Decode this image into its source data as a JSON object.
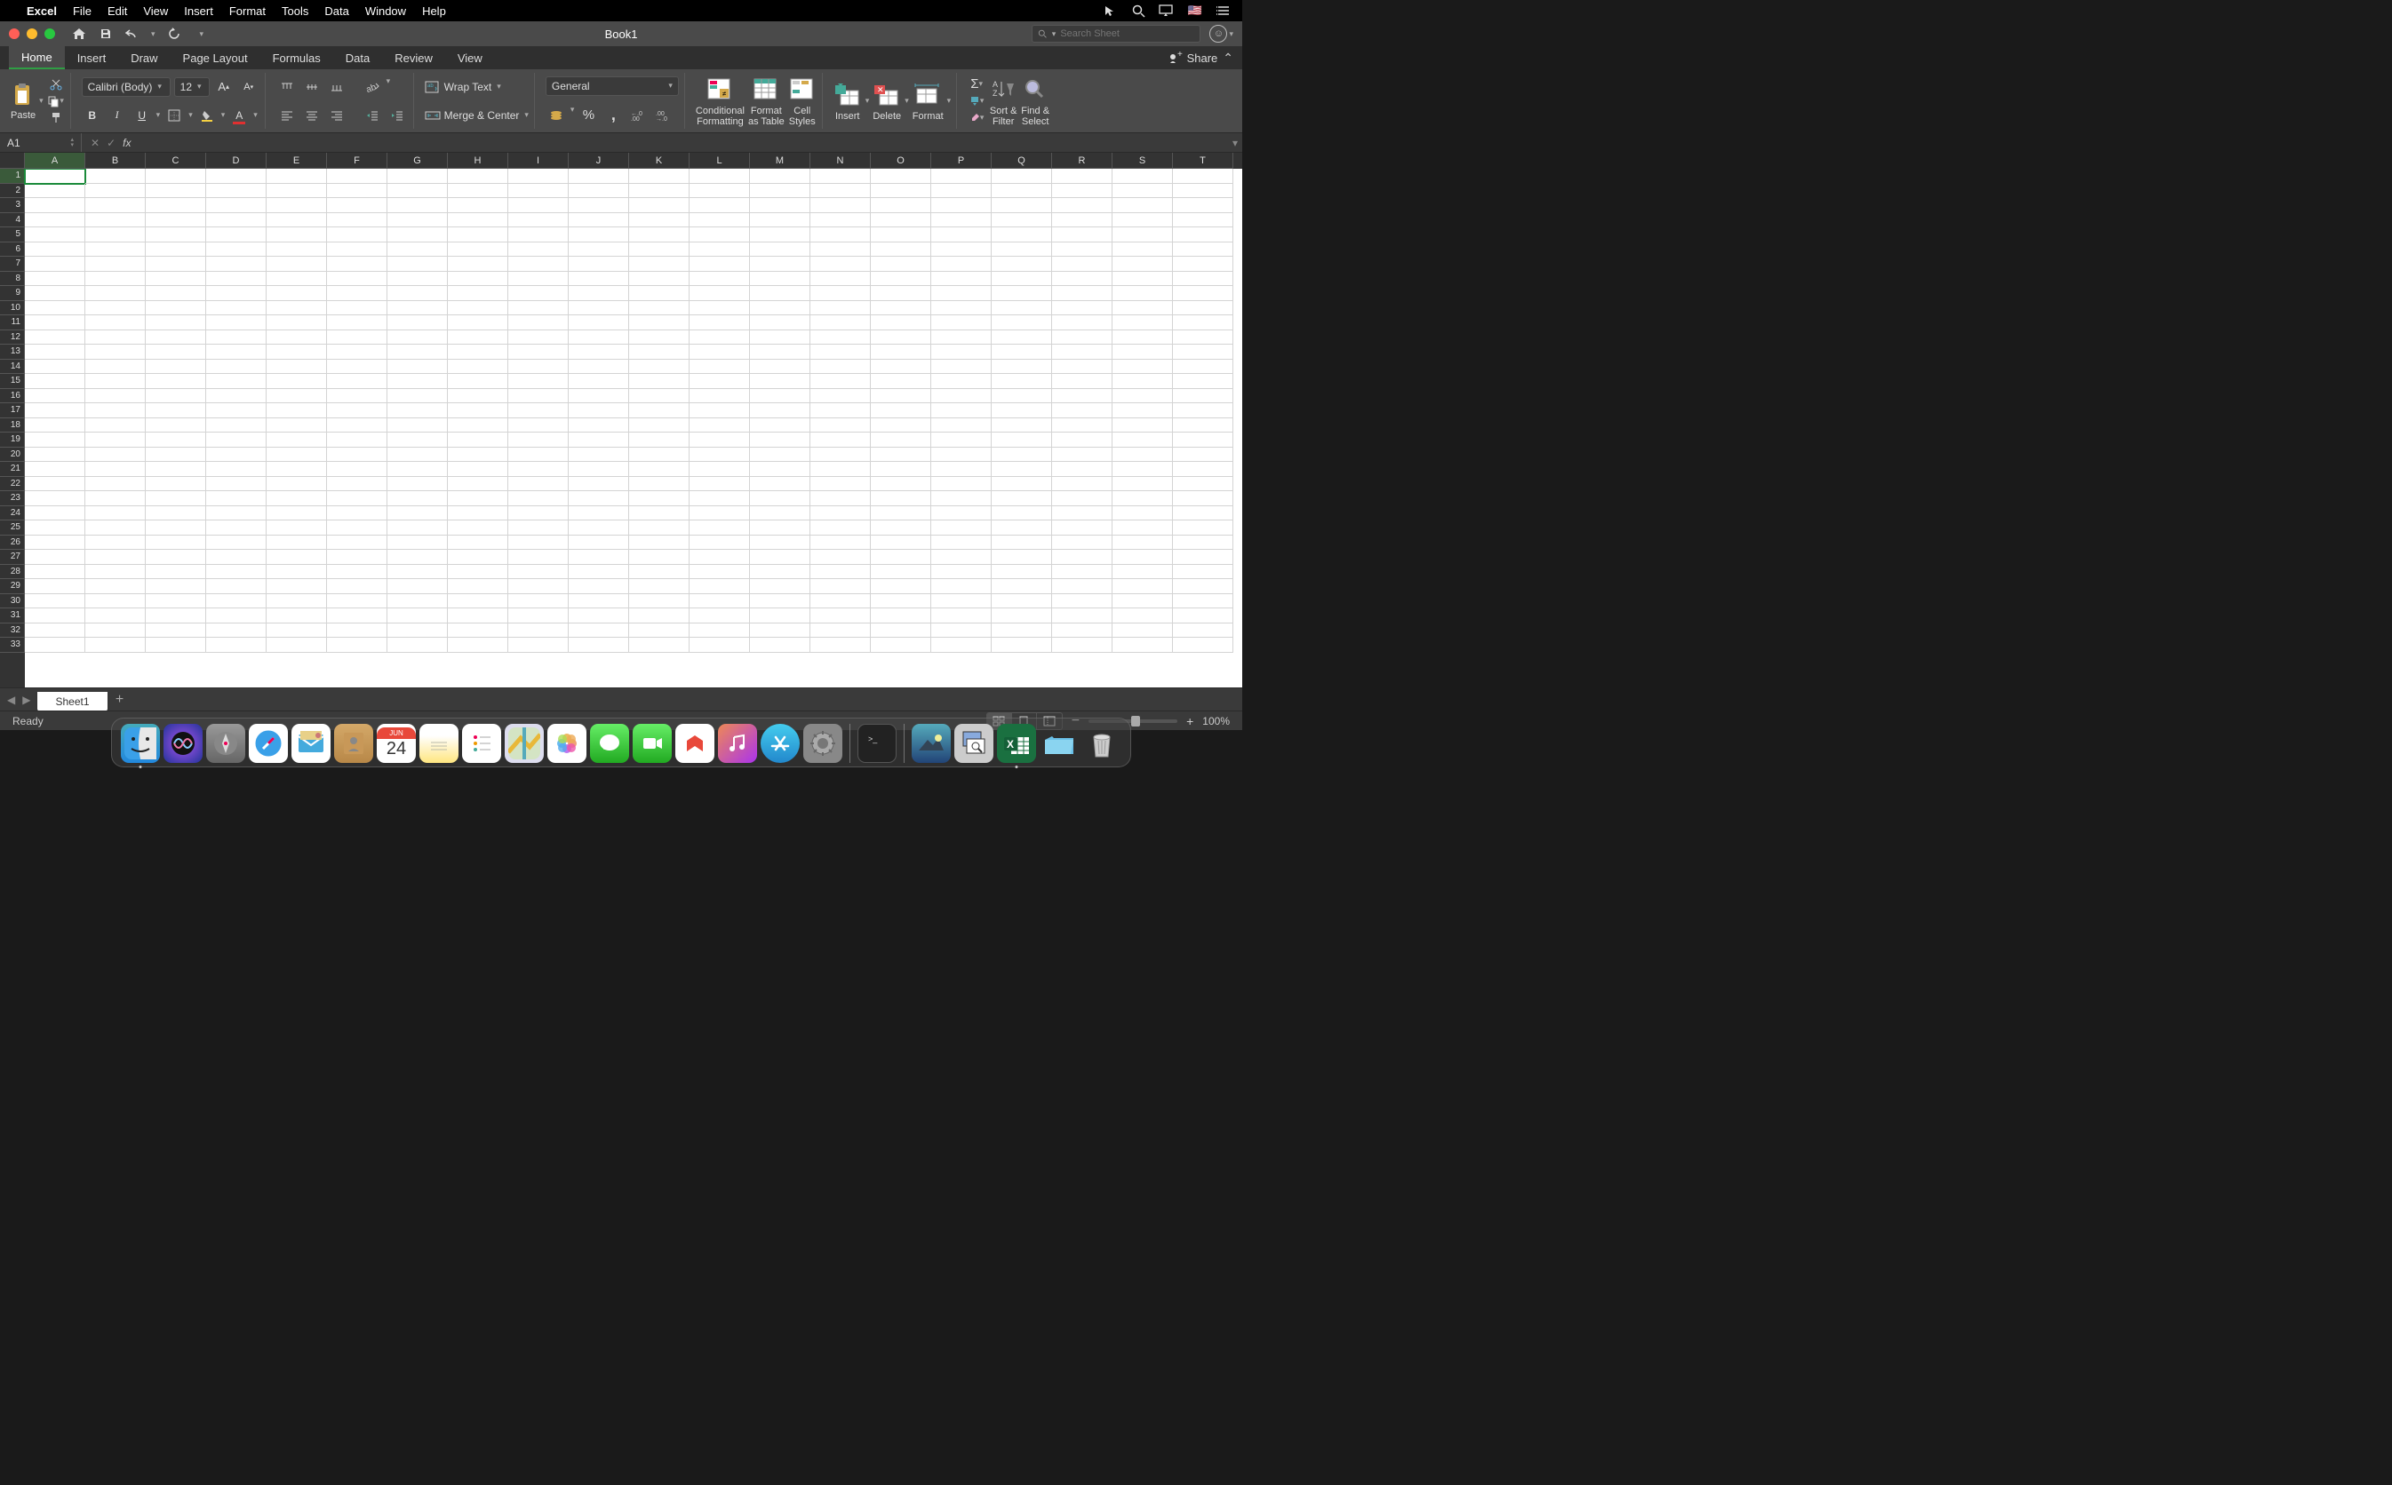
{
  "menubar": {
    "app": "Excel",
    "items": [
      "File",
      "Edit",
      "View",
      "Insert",
      "Format",
      "Tools",
      "Data",
      "Window",
      "Help"
    ]
  },
  "window": {
    "title": "Book1",
    "search_placeholder": "Search Sheet"
  },
  "ribbon": {
    "tabs": [
      "Home",
      "Insert",
      "Draw",
      "Page Layout",
      "Formulas",
      "Data",
      "Review",
      "View"
    ],
    "active_tab": "Home",
    "share": "Share",
    "paste": "Paste",
    "font_name": "Calibri (Body)",
    "font_size": "12",
    "wrap_text": "Wrap Text",
    "merge_center": "Merge & Center",
    "number_format": "General",
    "conditional_formatting": "Conditional\nFormatting",
    "format_as_table": "Format\nas Table",
    "cell_styles": "Cell\nStyles",
    "insert": "Insert",
    "delete": "Delete",
    "format": "Format",
    "sort_filter": "Sort &\nFilter",
    "find_select": "Find &\nSelect"
  },
  "formula_bar": {
    "cell_ref": "A1",
    "formula": ""
  },
  "grid": {
    "columns": [
      "A",
      "B",
      "C",
      "D",
      "E",
      "F",
      "G",
      "H",
      "I",
      "J",
      "K",
      "L",
      "M",
      "N",
      "O",
      "P",
      "Q",
      "R",
      "S",
      "T"
    ],
    "rows": 33,
    "selected_cell": "A1"
  },
  "sheet_tabs": {
    "active": "Sheet1"
  },
  "status": {
    "text": "Ready",
    "zoom": "100%"
  },
  "dock": {
    "items": [
      "finder",
      "siri",
      "launchpad",
      "safari",
      "mail",
      "contacts",
      "calendar",
      "notes",
      "reminders",
      "maps",
      "photos",
      "messages",
      "facetime",
      "news",
      "music",
      "appstore",
      "settings"
    ],
    "calendar_text": "24",
    "calendar_month": "JUN",
    "right_items": [
      "terminal",
      "screenshot",
      "preview",
      "excel",
      "downloads",
      "trash"
    ]
  }
}
